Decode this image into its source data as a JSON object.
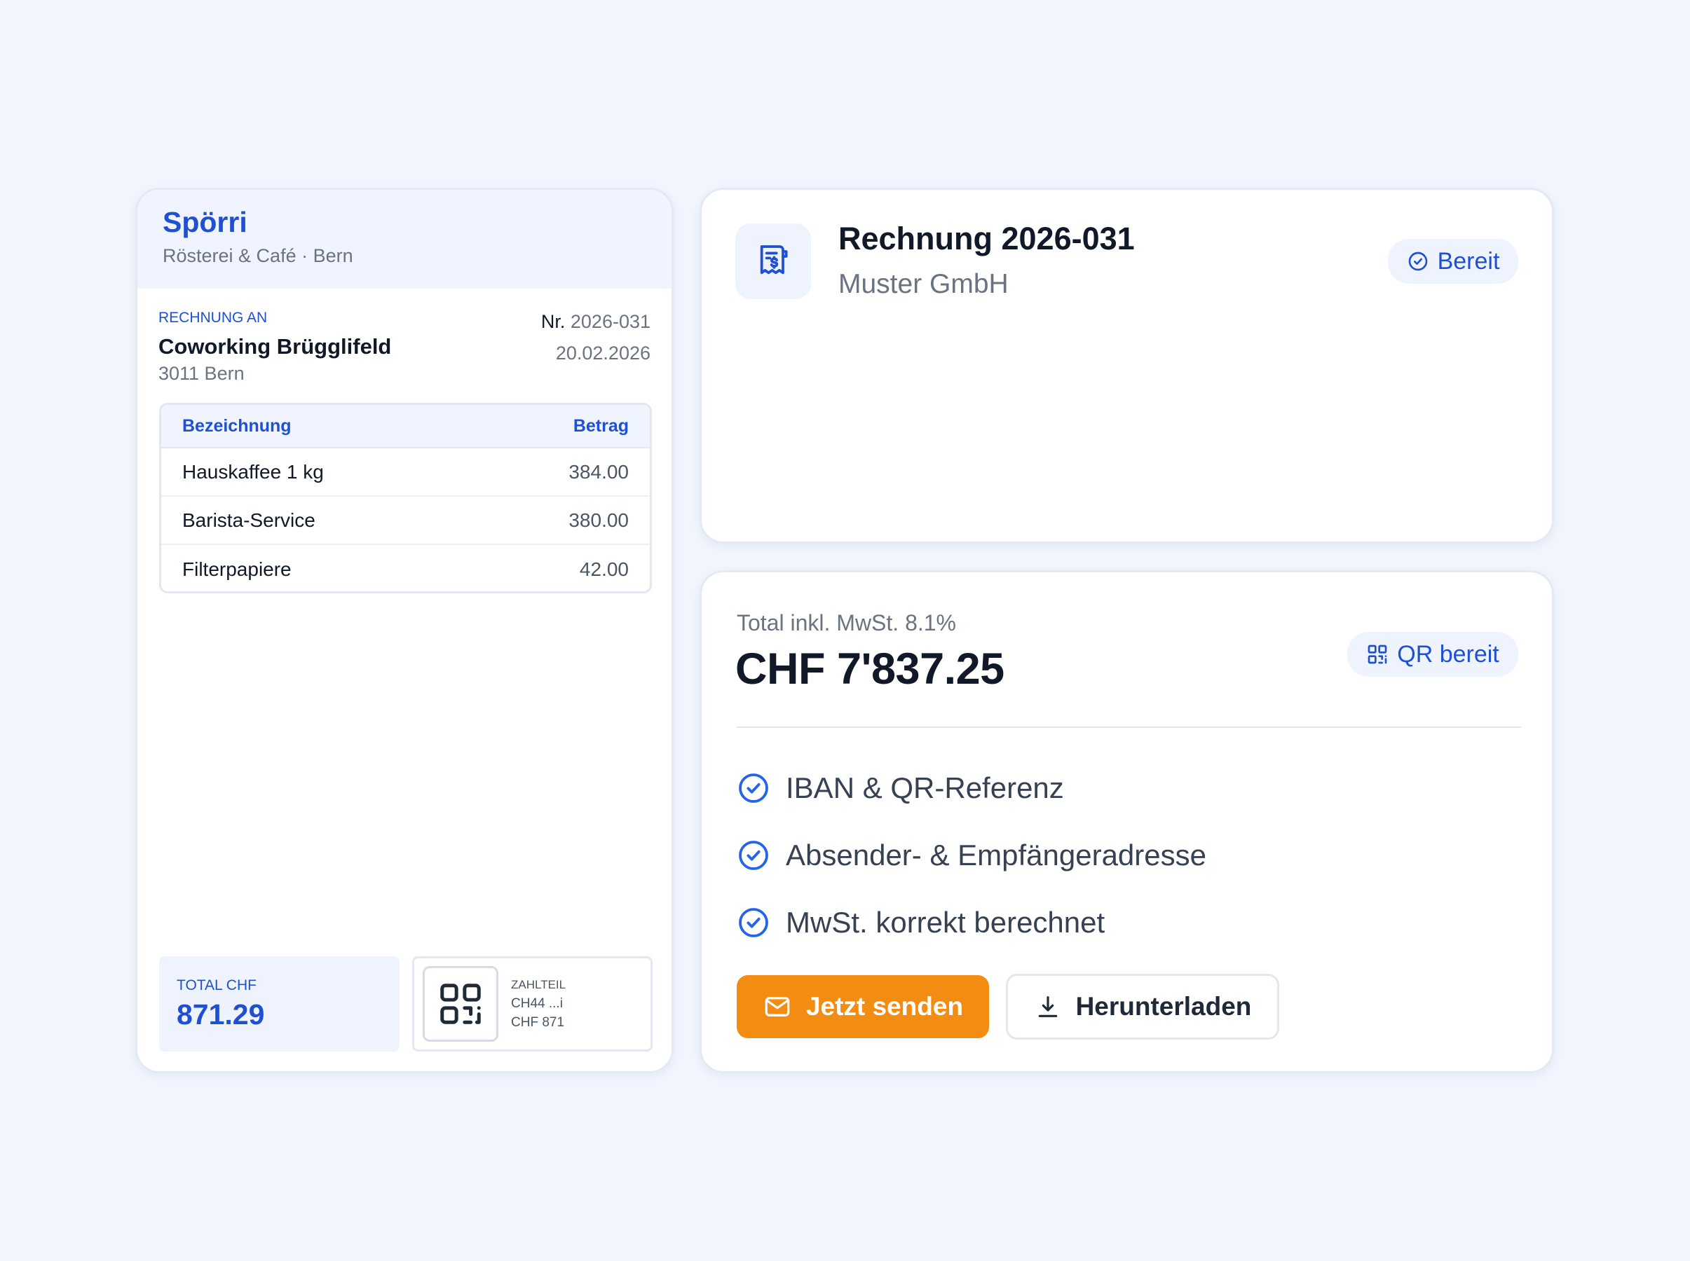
{
  "invoice_preview": {
    "brand": "Spörri",
    "brand_subtitle": "Rösterei & Café · Bern",
    "bill_to_label": "RECHNUNG AN",
    "bill_to_name": "Coworking Brügglifeld",
    "bill_to_city": "3011 Bern",
    "number_prefix": "Nr.",
    "number": "2026-031",
    "date": "20.02.2026",
    "table": {
      "headers": {
        "description": "Bezeichnung",
        "amount": "Betrag"
      },
      "rows": [
        {
          "description": "Hauskaffee 1 kg",
          "amount": "384.00"
        },
        {
          "description": "Barista-Service",
          "amount": "380.00"
        },
        {
          "description": "Filterpapiere",
          "amount": "42.00"
        }
      ]
    },
    "total_label": "TOTAL CHF",
    "total_value": "871.29",
    "payment_slip": {
      "label": "ZAHLTEIL",
      "iban": "CH44 ...i",
      "amount": "CHF 871"
    }
  },
  "summary": {
    "title": "Rechnung 2026-031",
    "customer": "Muster GmbH",
    "status_badge": "Bereit",
    "icon": "receipt-icon"
  },
  "payment": {
    "total_caption": "Total inkl. MwSt. 8.1%",
    "total_amount": "CHF 7'837.25",
    "qr_badge": "QR bereit",
    "checks": [
      "IBAN & QR-Referenz",
      "Absender- & Empfängeradresse",
      "MwSt. korrekt berechnet"
    ],
    "send_button": "Jetzt senden",
    "download_button": "Herunterladen"
  },
  "colors": {
    "accent_blue": "#1f50d2",
    "check_blue": "#2563eb",
    "send_orange": "#f28c12",
    "background": "#f0f5fe"
  }
}
